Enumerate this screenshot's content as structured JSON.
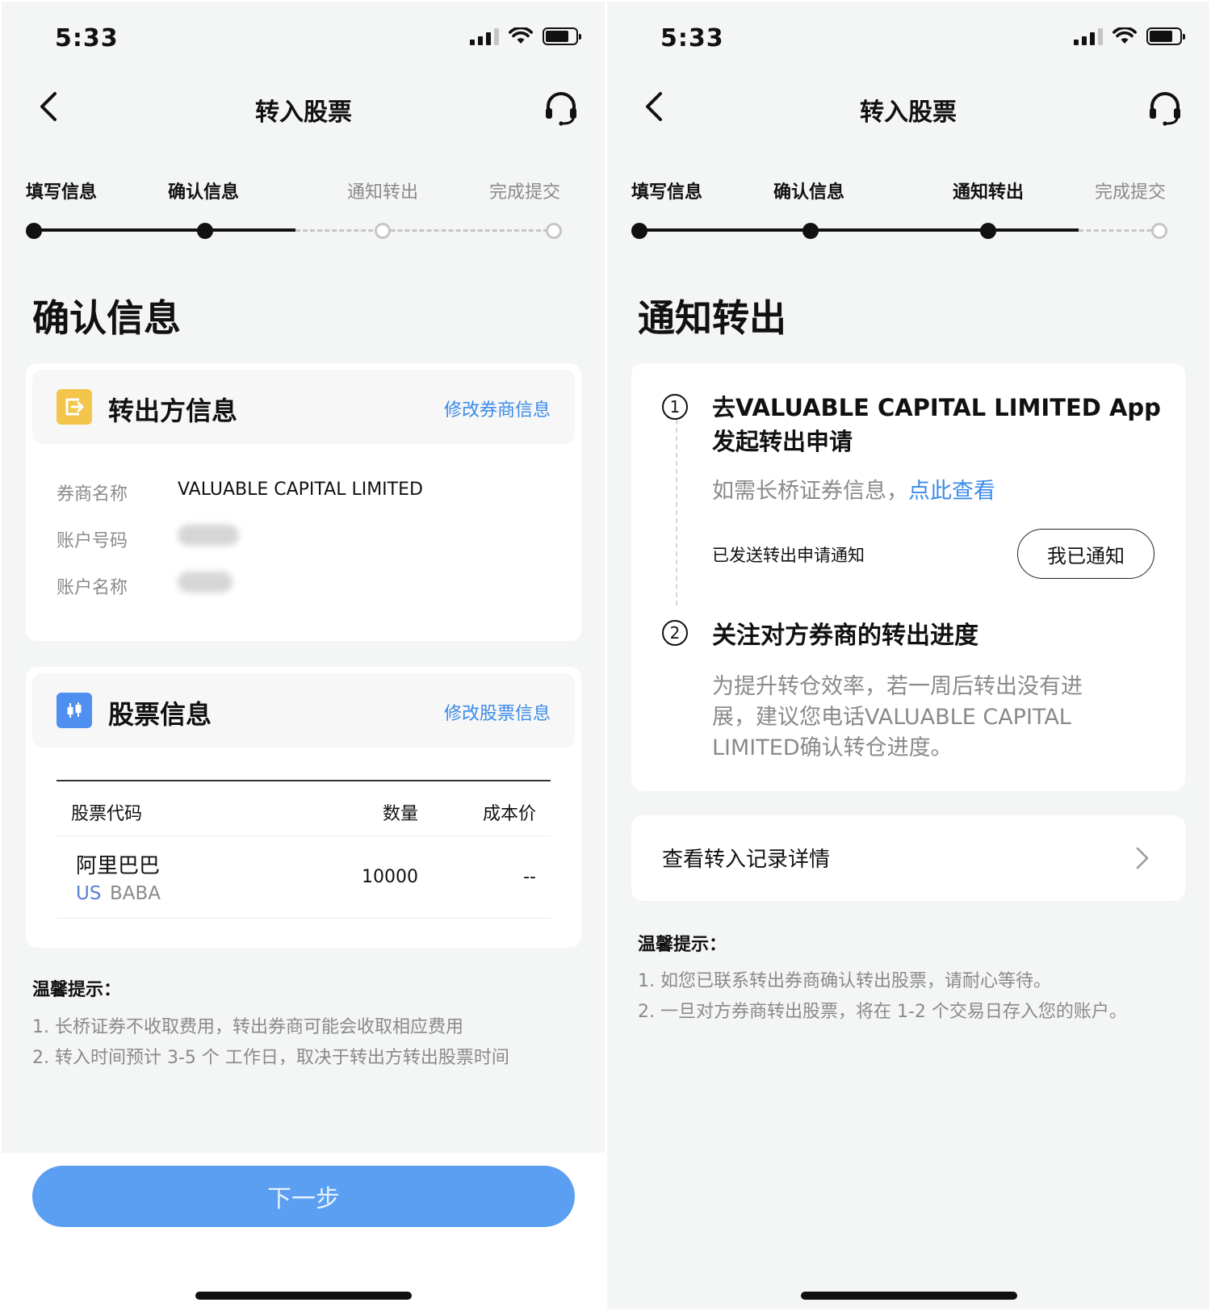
{
  "status": {
    "time": "5:33"
  },
  "nav": {
    "title": "转入股票"
  },
  "steps": [
    "填写信息",
    "确认信息",
    "通知转出",
    "完成提交"
  ],
  "left": {
    "section_title": "确认信息",
    "from_card": {
      "title": "转出方信息",
      "edit_link": "修改券商信息",
      "rows": [
        {
          "label": "券商名称",
          "value": "VALUABLE CAPITAL LIMITED"
        },
        {
          "label": "账户号码",
          "value": ""
        },
        {
          "label": "账户名称",
          "value": ""
        }
      ]
    },
    "stock_card": {
      "title": "股票信息",
      "edit_link": "修改股票信息",
      "columns": [
        "股票代码",
        "数量",
        "成本价"
      ],
      "rows": [
        {
          "name": "阿里巴巴",
          "market": "US",
          "ticker": "BABA",
          "quantity": "10000",
          "cost": "--"
        }
      ]
    },
    "tips": {
      "title": "温馨提示：",
      "items": [
        "1.  长桥证券不收取费用，转出券商可能会收取相应费用",
        "2.  转入时间预计 3-5 个 工作日，取决于转出方转出股票时间"
      ]
    },
    "next_button": "下一步"
  },
  "right": {
    "section_title": "通知转出",
    "step1": {
      "num": "1",
      "title_line1": "去VALUABLE CAPITAL LIMITED App",
      "title_line2": "发起转出申请",
      "hint": "如需长桥证券信息，",
      "hint_link": "点此查看",
      "sent_label": "已发送转出申请通知",
      "notify_button": "我已通知"
    },
    "step2": {
      "num": "2",
      "title": "关注对方券商的转出进度",
      "desc_line1": "为提升转仓效率，若一周后转出没有进",
      "desc_line2": "展，建议您电话VALUABLE CAPITAL",
      "desc_line3": "LIMITED确认转仓进度。"
    },
    "record_link": "查看转入记录详情",
    "tips": {
      "title": "温馨提示：",
      "items": [
        "1.  如您已联系转出券商确认转出股票，请耐心等待。",
        "2.  一旦对方券商转出股票，将在 1-2 个交易日存入您的账户。"
      ]
    }
  },
  "colors": {
    "accent": "#3b8be8",
    "button": "#5a9ff2",
    "market": "#5b7fd6",
    "broker_icon": "#f3c54b",
    "stock_icon": "#4e8ff0"
  }
}
